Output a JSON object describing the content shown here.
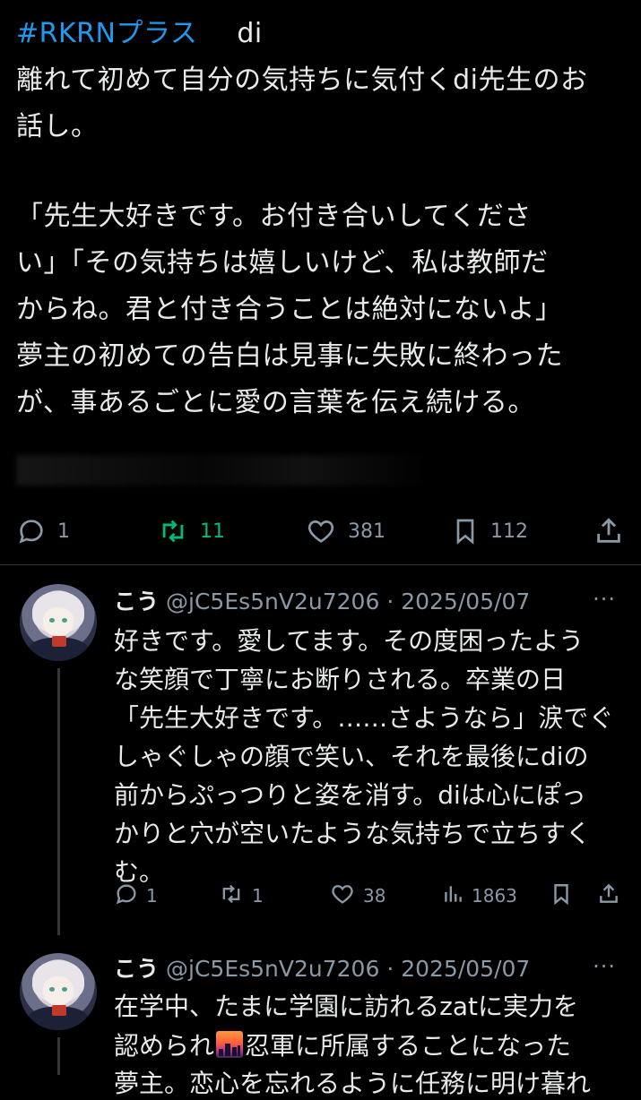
{
  "main_post": {
    "hashtag": "#RKRNプラス",
    "title_tail": "di",
    "lines": [
      "離れて初めて自分の気持ちに気付くdi先生のお",
      "話し。",
      "「先生大好きです。お付き合いしてくださ",
      "い」「その気持ちは嬉しいけど、私は教師だ",
      "からね。君と付き合うことは絶対にないよ」",
      "夢主の初めての告白は見事に失敗に終わった",
      "が、事あるごとに愛の言葉を伝え続ける。"
    ],
    "actions": {
      "reply_count": "1",
      "retweet_count": "11",
      "like_count": "381",
      "bookmark_count": "112"
    },
    "colors": {
      "hashtag": "#1d9bf0",
      "retweet_active": "#00ba7c",
      "muted": "#8b98a5"
    }
  },
  "replies": [
    {
      "name": "こう",
      "handle_date": "@jC5Es5nV2u7206 · 2025/05/07",
      "more": "···",
      "lines": [
        "好きです。愛してます。その度困ったよう",
        "な笑顔で丁寧にお断りされる。卒業の日",
        "「先生大好きです。……さようなら」涙でぐ",
        "しゃぐしゃの顔で笑い、それを最後にdiの",
        "前からぷっつりと姿を消す。diは心にぽっ",
        "かりと穴が空いたような気持ちで立ちすく",
        "む。"
      ],
      "actions": {
        "reply": "1",
        "retweet": "1",
        "like": "38",
        "views": "1863"
      }
    },
    {
      "name": "こう",
      "handle_date": "@jC5Es5nV2u7206 · 2025/05/07",
      "more": "···",
      "line1": "在学中、たまに学園に訪れるzatに実力を",
      "line2_a": "認められ",
      "line2_b": "忍軍に所属することになった",
      "line3": "夢主。恋心を忘れるように任務に明け暮れ"
    }
  ]
}
